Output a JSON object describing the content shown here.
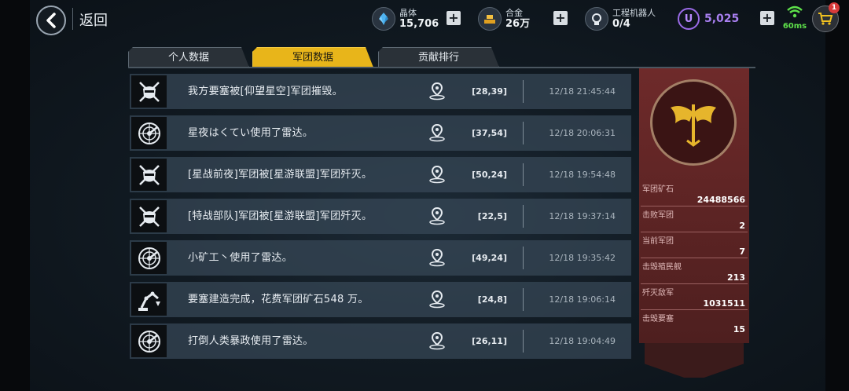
{
  "header": {
    "back_label": "返回",
    "crystal": {
      "label": "晶体",
      "value": "15,706"
    },
    "alloy": {
      "label": "合金",
      "value": "26万"
    },
    "robot": {
      "label": "工程机器人",
      "value": "0/4"
    },
    "u_coin": {
      "symbol": "U",
      "value": "5,025"
    },
    "ping": "60ms",
    "cart_badge": "1"
  },
  "tabs": [
    {
      "label": "个人数据",
      "active": false
    },
    {
      "label": "军团数据",
      "active": true
    },
    {
      "label": "贡献排行",
      "active": false
    }
  ],
  "events": [
    {
      "icon": "legion-destroyed-icon",
      "message": "我方要塞被[仰望星空]军团摧毁。",
      "coord": "[28,39]",
      "time": "12/18 21:45:44"
    },
    {
      "icon": "radar-icon",
      "message": "星夜はくてい使用了雷达。",
      "coord": "[37,54]",
      "time": "12/18 20:06:31"
    },
    {
      "icon": "legion-destroyed-icon",
      "message": "[星战前夜]军团被[星游联盟]军团歼灭。",
      "coord": "[50,24]",
      "time": "12/18 19:54:48"
    },
    {
      "icon": "legion-destroyed-icon",
      "message": "[特战部队]军团被[星游联盟]军团歼灭。",
      "coord": "[22,5]",
      "time": "12/18 19:37:14"
    },
    {
      "icon": "radar-icon",
      "message": "小矿工丶使用了雷达。",
      "coord": "[49,24]",
      "time": "12/18 19:35:42"
    },
    {
      "icon": "construction-robot-icon",
      "message": "要塞建造完成，花费军团矿石548 万。",
      "coord": "[24,8]",
      "time": "12/18 19:06:14"
    },
    {
      "icon": "radar-icon",
      "message": "打倒人类暴政使用了雷达。",
      "coord": "[26,11]",
      "time": "12/18 19:04:49"
    }
  ],
  "stats": [
    {
      "label": "军团矿石",
      "value": "24488566"
    },
    {
      "label": "击败军团",
      "value": "2"
    },
    {
      "label": "当前军团",
      "value": "7"
    },
    {
      "label": "击毁殖民舰",
      "value": "213"
    },
    {
      "label": "歼灭敌军",
      "value": "1031511"
    },
    {
      "label": "击毁要塞",
      "value": "15"
    }
  ],
  "colors": {
    "accent": "#e8b51a",
    "panel": "#6e2a2a",
    "ping": "#5ee04a",
    "u_coin": "#a87ff0"
  }
}
